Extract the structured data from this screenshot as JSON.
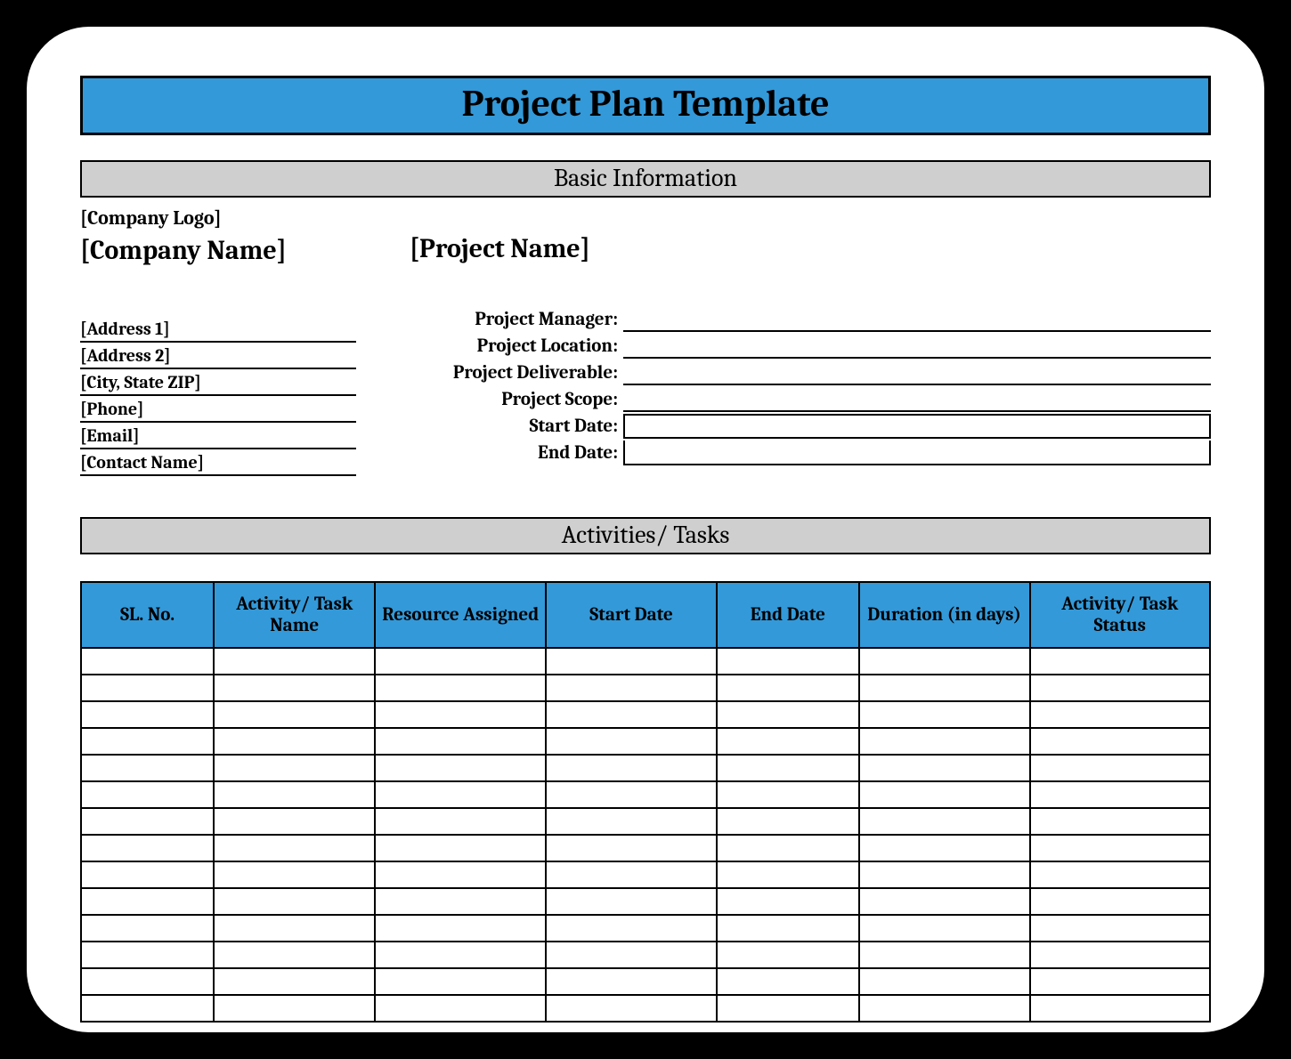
{
  "title": "Project Plan Template",
  "sections": {
    "basic_info": "Basic Information",
    "activities": "Activities/ Tasks"
  },
  "company": {
    "logo_label": "[Company Logo]",
    "name_label": "[Company Name]",
    "address1": "[Address 1]",
    "address2": "[Address 2]",
    "city_state_zip": "[City, State ZIP]",
    "phone": "[Phone]",
    "email": "[Email]",
    "contact_name": "[Contact Name]"
  },
  "project": {
    "name_label": "[Project Name]",
    "fields": {
      "manager": "Project Manager:",
      "location": "Project Location:",
      "deliverable": "Project Deliverable:",
      "scope": "Project Scope:",
      "start_date": "Start Date:",
      "end_date": "End Date:"
    }
  },
  "table": {
    "headers": {
      "sl_no": "SL. No.",
      "activity": "Activity/ Task Name",
      "resource": "Resource Assigned",
      "start": "Start Date",
      "end": "End Date",
      "duration": "Duration (in days)",
      "status": "Activity/ Task Status"
    },
    "row_count": 14
  },
  "colors": {
    "header_blue": "#3399d9",
    "section_grey": "#cfcfcf"
  }
}
